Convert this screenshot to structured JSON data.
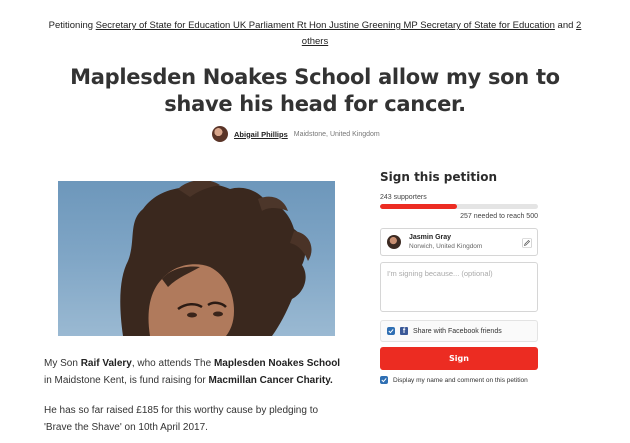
{
  "header": {
    "petitioning_prefix": "Petitioning",
    "targets_link": "Secretary of State for Education UK Parliament Rt Hon Justine Greening MP Secretary of State for Education",
    "and_text": "and",
    "others_link": "2 others"
  },
  "petition": {
    "title": "Maplesden Noakes School allow my son to shave his head for cancer.",
    "author_name": "Abigail Phillips",
    "author_location": "Maidstone, United Kingdom"
  },
  "story": {
    "p1_a": "My Son ",
    "p1_name": "Raif Valery",
    "p1_b": ", who attends The ",
    "p1_school": "Maplesden Noakes School",
    "p1_c": " in Maidstone Kent, is fund raising for ",
    "p1_charity": "Macmillan Cancer Charity.",
    "p2": "He has so far raised £185 for this worthy cause by pledging to 'Brave the Shave' on 10th April 2017."
  },
  "sign": {
    "heading": "Sign this petition",
    "supporters": "243 supporters",
    "progress_fraction": 0.486,
    "needed": "257 needed to reach 500",
    "user_name": "Jasmin Gray",
    "user_location": "Norwich, United Kingdom",
    "reason_placeholder": "I'm signing because... (optional)",
    "share_label": "Share with Facebook friends",
    "button_label": "Sign",
    "display_label": "Display my name and comment on this petition"
  },
  "icons": {
    "edit": "pencil-icon",
    "facebook": "facebook-icon",
    "checkbox": "check-icon"
  },
  "colors": {
    "accent": "#ec2c22",
    "facebook": "#3b5998",
    "checkbox": "#2f6fb3"
  }
}
